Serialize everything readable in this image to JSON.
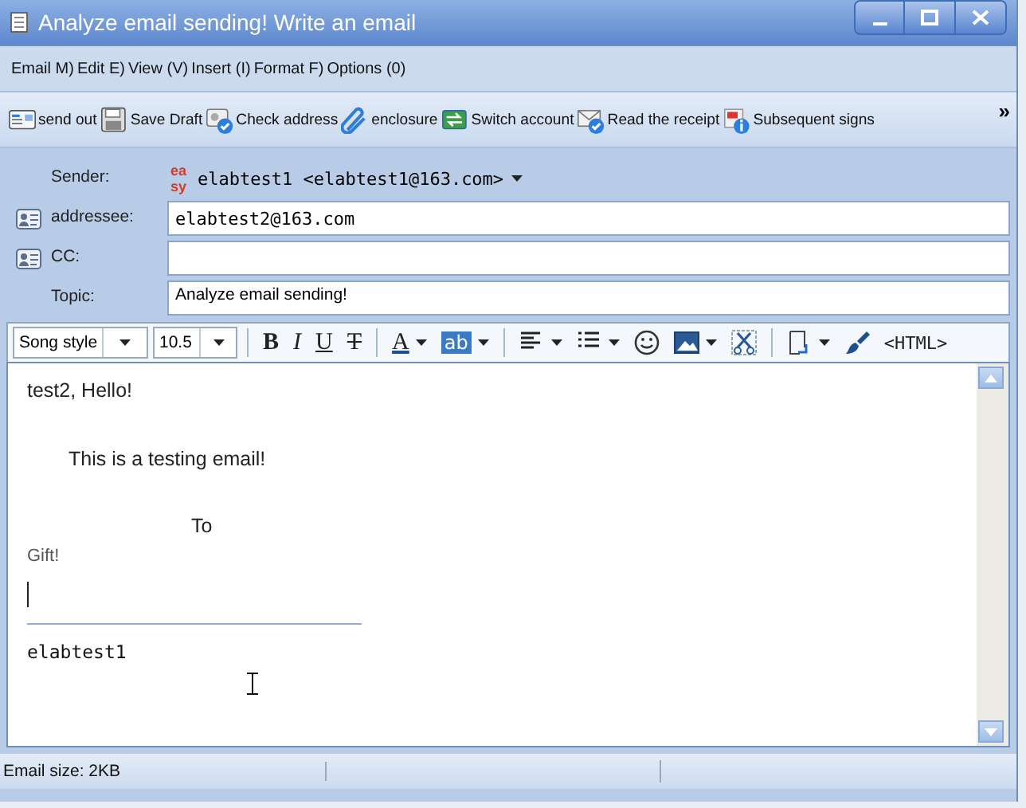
{
  "window": {
    "title": "Analyze email sending! Write an email"
  },
  "menu": [
    "Email M)",
    "Edit E)",
    "View (V)",
    "Insert (I)",
    "Format F)",
    "Options (0)"
  ],
  "toolbar": [
    {
      "label": "send out"
    },
    {
      "label": "Save Draft"
    },
    {
      "label": "Check address"
    },
    {
      "label": "enclosure"
    },
    {
      "label": "Switch account"
    },
    {
      "label": "Read the receipt"
    },
    {
      "label": "Subsequent signs"
    }
  ],
  "toolbar_overflow": "»",
  "header": {
    "sender": {
      "label": "Sender:",
      "logo": [
        "ea",
        "sy"
      ],
      "value": "elabtest1 <elabtest1@163.com>"
    },
    "fields": [
      {
        "label": "addressee:",
        "value": "elabtest2@163.com",
        "contacts": true
      },
      {
        "label": "CC:",
        "contacts": true
      },
      {
        "label": "Topic:",
        "value": "Analyze email sending!",
        "contacts": false
      }
    ]
  },
  "format_bar": {
    "font": "Song style",
    "size": "10.5",
    "tools": [
      {
        "kind": "bold",
        "text": "B",
        "dropdown": false
      },
      {
        "kind": "italic",
        "text": "I",
        "dropdown": false
      },
      {
        "kind": "underline",
        "text": "U",
        "dropdown": false
      },
      {
        "kind": "strike",
        "text": "T",
        "dropdown": false
      },
      {
        "kind": "separator"
      },
      {
        "kind": "color",
        "text": "A",
        "dropdown": true
      },
      {
        "kind": "highlight",
        "text": "ab",
        "dropdown": true
      },
      {
        "kind": "separator"
      },
      {
        "kind": "align",
        "dropdown": true
      },
      {
        "kind": "list",
        "dropdown": true
      },
      {
        "kind": "smiley",
        "dropdown": false
      },
      {
        "kind": "image",
        "dropdown": true
      },
      {
        "kind": "scissors",
        "dropdown": false
      },
      {
        "kind": "separator"
      },
      {
        "kind": "insert",
        "dropdown": true
      },
      {
        "kind": "brush",
        "dropdown": false
      },
      {
        "kind": "html",
        "text": "<HTML>",
        "dropdown": false
      }
    ]
  },
  "body": [
    {
      "kind": "plain",
      "text": "test2, Hello!"
    },
    {
      "kind": "indent",
      "text": "This is a testing email!"
    },
    {
      "kind": "offset",
      "text": "To"
    },
    {
      "kind": "small",
      "text": "Gift!"
    },
    {
      "kind": "caret"
    },
    {
      "kind": "rule"
    },
    {
      "kind": "mono",
      "text": "elabtest1"
    }
  ],
  "status_bar": {
    "size": "Email size: 2KB"
  }
}
